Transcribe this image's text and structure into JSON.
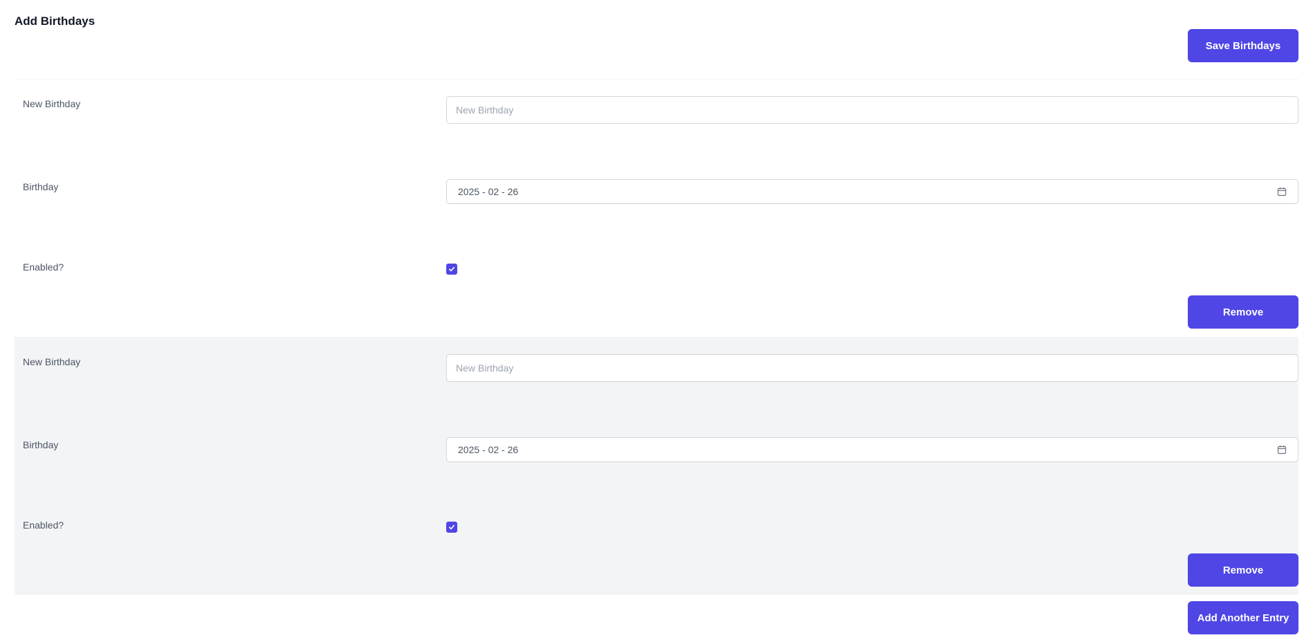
{
  "header": {
    "title": "Add Birthdays",
    "save_label": "Save Birthdays"
  },
  "entries": [
    {
      "name_label": "New Birthday",
      "name_placeholder": "New Birthday",
      "name_value": "",
      "birthday_label": "Birthday",
      "birthday_value": "2025 - 02 - 26",
      "enabled_label": "Enabled?",
      "enabled": true,
      "remove_label": "Remove"
    },
    {
      "name_label": "New Birthday",
      "name_placeholder": "New Birthday",
      "name_value": "",
      "birthday_label": "Birthday",
      "birthday_value": "2025 - 02 - 26",
      "enabled_label": "Enabled?",
      "enabled": true,
      "remove_label": "Remove"
    }
  ],
  "footer": {
    "add_label": "Add Another Entry"
  },
  "colors": {
    "accent": "#4f46e5",
    "alt_row_bg": "#f3f4f6"
  },
  "icons": {
    "date_picker": "calendar-icon",
    "checkbox": "check-icon"
  }
}
